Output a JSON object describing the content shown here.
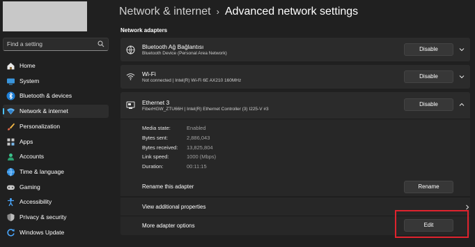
{
  "sidebar": {
    "search_placeholder": "Find a setting",
    "items": [
      {
        "label": "Home",
        "icon": "home-icon"
      },
      {
        "label": "System",
        "icon": "system-icon"
      },
      {
        "label": "Bluetooth & devices",
        "icon": "bluetooth-icon"
      },
      {
        "label": "Network & internet",
        "icon": "network-icon",
        "active": true
      },
      {
        "label": "Personalization",
        "icon": "brush-icon"
      },
      {
        "label": "Apps",
        "icon": "apps-icon"
      },
      {
        "label": "Accounts",
        "icon": "accounts-icon"
      },
      {
        "label": "Time & language",
        "icon": "globe-icon"
      },
      {
        "label": "Gaming",
        "icon": "gaming-icon"
      },
      {
        "label": "Accessibility",
        "icon": "accessibility-icon"
      },
      {
        "label": "Privacy & security",
        "icon": "shield-icon"
      },
      {
        "label": "Windows Update",
        "icon": "update-icon"
      }
    ]
  },
  "header": {
    "parent": "Network & internet",
    "separator": "›",
    "current": "Advanced network settings"
  },
  "section_title": "Network adapters",
  "adapters": [
    {
      "name": "Bluetooth Ağ Bağlantısı",
      "detail": "Bluetooth Device (Personal Area Network)",
      "button": "Disable",
      "icon": "bluetooth-network-icon"
    },
    {
      "name": "Wi-Fi",
      "detail": "Not connected | Intel(R) Wi-Fi 6E AX210 160MHz",
      "button": "Disable",
      "icon": "wifi-icon"
    },
    {
      "name": "Ethernet 3",
      "detail": "FiberHGW_ZTU66H | Intel(R) Ethernet Controller (3) I225-V #3",
      "button": "Disable",
      "icon": "ethernet-icon"
    }
  ],
  "properties": [
    {
      "key": "Media state:",
      "value": "Enabled"
    },
    {
      "key": "Bytes sent:",
      "value": "2,886,043"
    },
    {
      "key": "Bytes received:",
      "value": "13,825,804"
    },
    {
      "key": "Link speed:",
      "value": "1000 (Mbps)"
    },
    {
      "key": "Duration:",
      "value": "00:11:15"
    }
  ],
  "rename": {
    "label": "Rename this adapter",
    "button": "Rename"
  },
  "view_props": {
    "label": "View additional properties"
  },
  "more_options": {
    "label": "More adapter options",
    "button": "Edit"
  },
  "colors": {
    "accent": "#4cc2ff",
    "highlight": "#e0232e",
    "background": "#202020",
    "card": "#2b2b2b"
  }
}
